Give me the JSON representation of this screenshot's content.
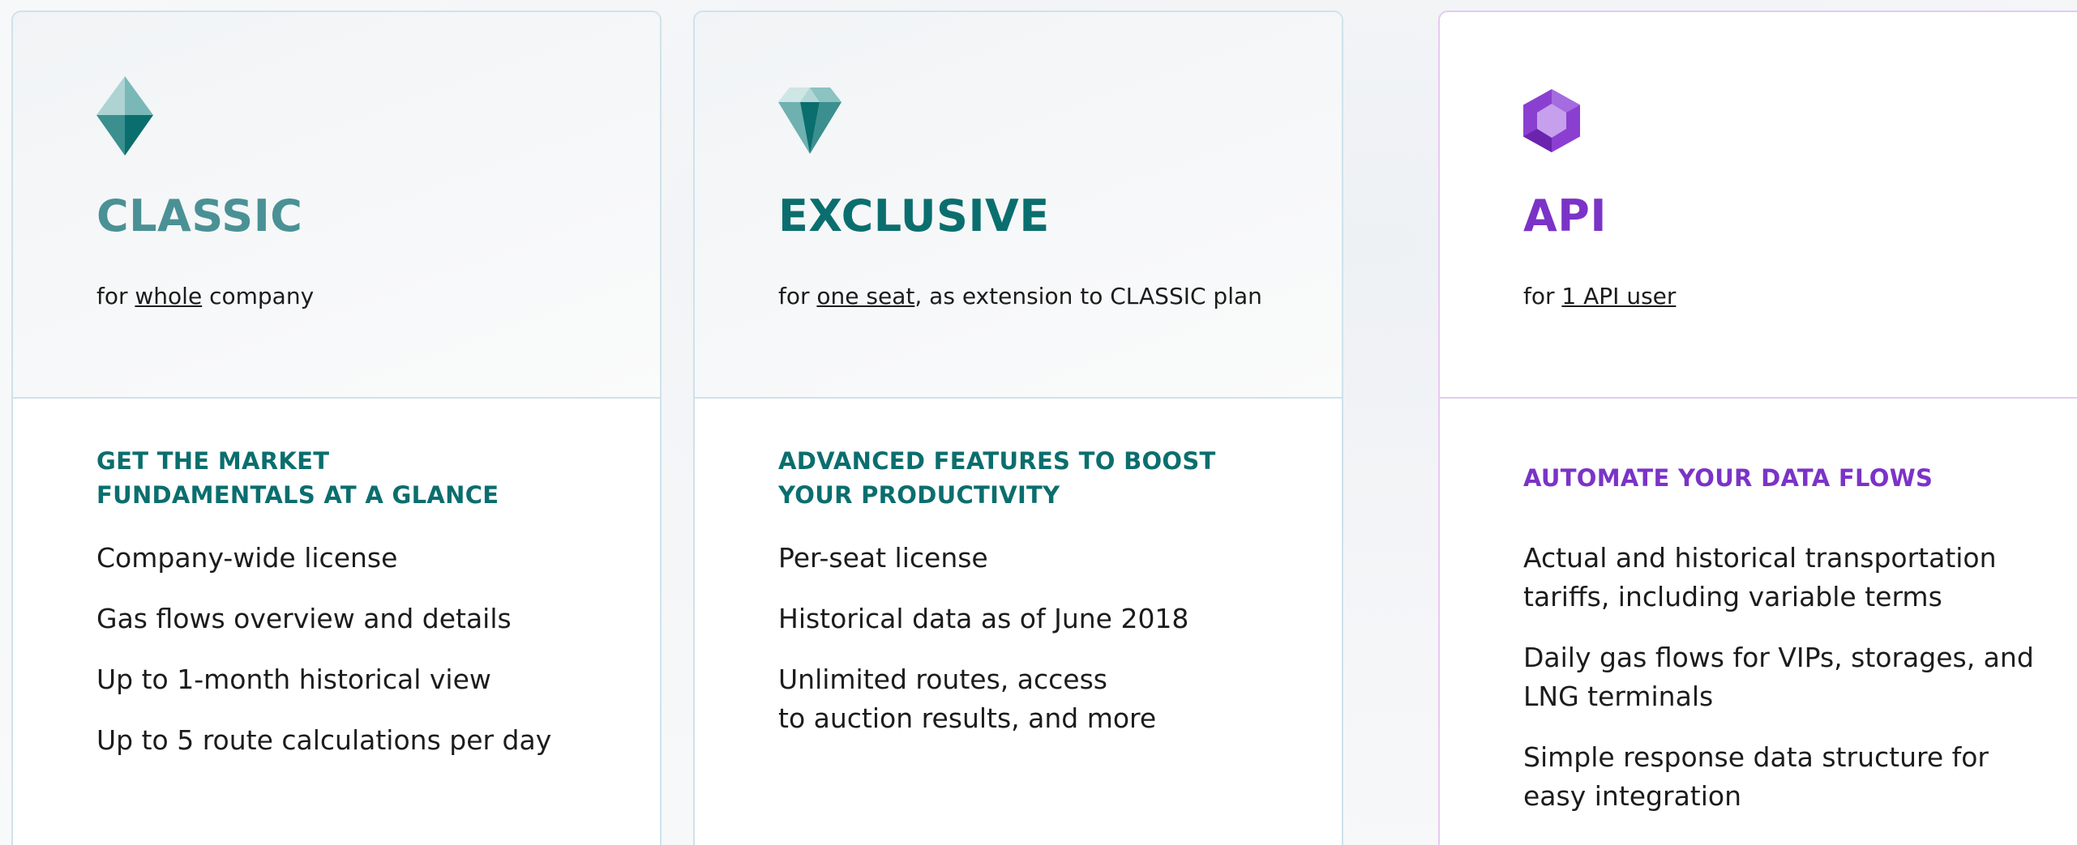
{
  "colors": {
    "classic_title": "#4a9195",
    "exclusive_title": "#0b6e6e",
    "teal_tagline": "#0b6e6e",
    "api_accent": "#7b33c7",
    "card_border": "#cfe2eb",
    "api_border": "#e7c9f0"
  },
  "plans": [
    {
      "icon": "crystal-icon",
      "name": "CLASSIC",
      "sub_prefix": "for ",
      "sub_emphasis": "whole",
      "sub_suffix": " company",
      "tagline": "GET THE MARKET\nFUNDAMENTALS AT A GLANCE",
      "features": [
        "Company-wide license",
        "Gas flows overview and details",
        "Up to 1-month historical view",
        "Up to 5 route calculations per day"
      ]
    },
    {
      "icon": "diamond-icon",
      "name": "EXCLUSIVE",
      "sub_prefix": "for ",
      "sub_emphasis": "one seat",
      "sub_suffix": ", as extension to CLASSIC plan",
      "tagline": "ADVANCED FEATURES TO BOOST\nYOUR PRODUCTIVITY",
      "features": [
        "Per-seat license",
        "Historical data as of June 2018",
        "Unlimited routes, access\nto auction results, and more"
      ]
    },
    {
      "icon": "hexagon-gem-icon",
      "name": "API",
      "sub_prefix": "for ",
      "sub_emphasis": "1 API user",
      "sub_suffix": "",
      "tagline": "AUTOMATE YOUR DATA FLOWS",
      "features": [
        "Actual and historical transportation\ntariffs, including variable terms",
        "Daily gas flows for VIPs, storages, and\nLNG terminals",
        "Simple response data structure for\neasy integration"
      ]
    }
  ]
}
